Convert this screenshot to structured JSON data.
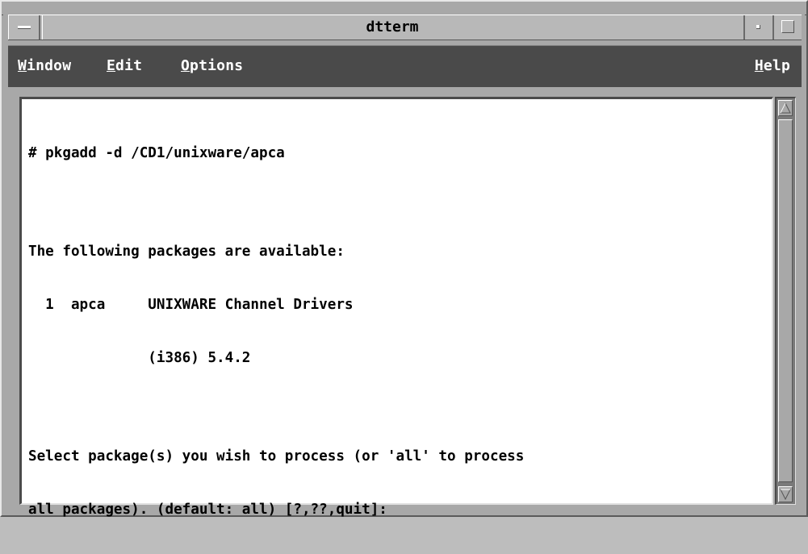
{
  "window": {
    "title": "dtterm"
  },
  "menubar": {
    "window": {
      "mnemonic": "W",
      "rest": "indow"
    },
    "edit": {
      "mnemonic": "E",
      "rest": "dit"
    },
    "options": {
      "mnemonic": "O",
      "rest": "ptions"
    },
    "help": {
      "mnemonic": "H",
      "rest": "elp"
    }
  },
  "terminal": {
    "lines": [
      "# pkgadd -d /CD1/unixware/apca",
      "",
      "The following packages are available:",
      "  1  apca     UNIXWARE Channel Drivers",
      "              (i386) 5.4.2",
      "",
      "Select package(s) you wish to process (or 'all' to process",
      "all packages). (default: all) [?,??,quit]:"
    ]
  },
  "icons": {
    "window_menu": "window-menu-icon",
    "minimize": "minimize-icon",
    "maximize": "maximize-icon",
    "scroll_up": "arrow-up-icon",
    "scroll_down": "arrow-down-icon"
  }
}
